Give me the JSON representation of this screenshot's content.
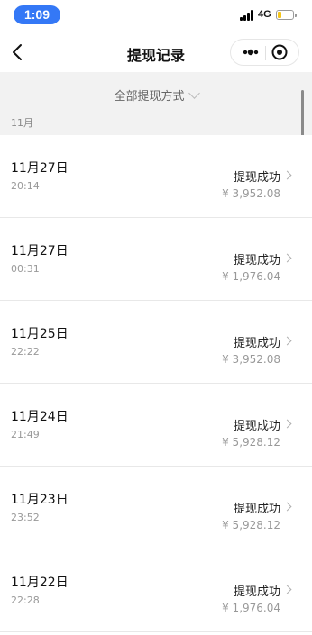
{
  "status_bar": {
    "time": "1:09",
    "network": "4G"
  },
  "nav": {
    "title": "提现记录"
  },
  "filter": {
    "label": "全部提现方式",
    "month": "11月"
  },
  "records": [
    {
      "date": "11月27日",
      "time": "20:14",
      "status": "提现成功",
      "amount": "¥ 3,952.08"
    },
    {
      "date": "11月27日",
      "time": "00:31",
      "status": "提现成功",
      "amount": "¥ 1,976.04"
    },
    {
      "date": "11月25日",
      "time": "22:22",
      "status": "提现成功",
      "amount": "¥ 3,952.08"
    },
    {
      "date": "11月24日",
      "time": "21:49",
      "status": "提现成功",
      "amount": "¥ 5,928.12"
    },
    {
      "date": "11月23日",
      "time": "23:52",
      "status": "提现成功",
      "amount": "¥ 5,928.12"
    },
    {
      "date": "11月22日",
      "time": "22:28",
      "status": "提现成功",
      "amount": "¥ 1,976.04"
    }
  ],
  "colors": {
    "accent": "#3478f6",
    "battery": "#f5c518",
    "filter_bg": "#f2f2f2"
  }
}
